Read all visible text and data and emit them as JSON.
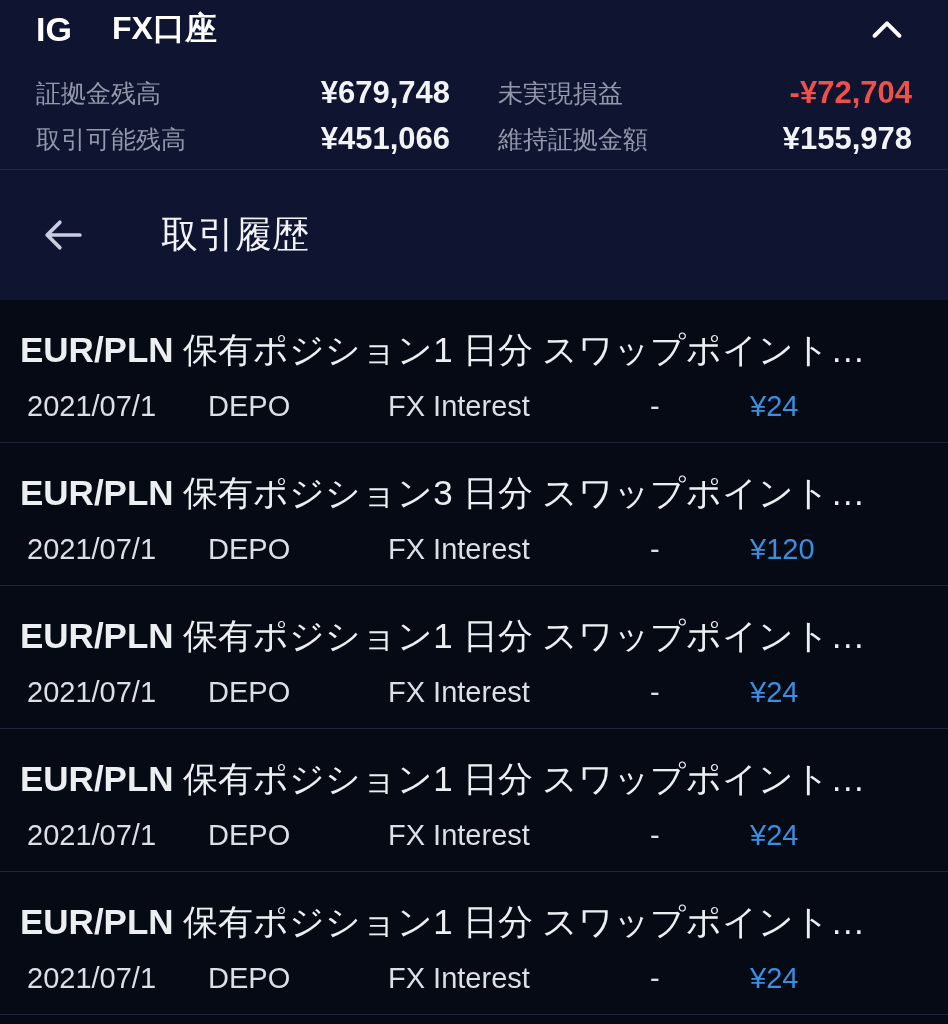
{
  "account": {
    "logo": "IG",
    "title": "FX口座",
    "expanded": true,
    "stats": [
      {
        "label": "証拠金残高",
        "value": "¥679,748",
        "negative": false
      },
      {
        "label": "未実現損益",
        "value": "-¥72,704",
        "negative": true
      },
      {
        "label": "取引可能残高",
        "value": "¥451,066",
        "negative": false
      },
      {
        "label": "維持証拠金額",
        "value": "¥155,978",
        "negative": false
      }
    ]
  },
  "nav": {
    "title": "取引履歴"
  },
  "transactions": [
    {
      "title": "**EUR/PLN** 保有ポジション1 日分 スワップポイント…",
      "date": "2021/07/1",
      "type": "DEPO",
      "description": "FX Interest",
      "column_4": "-",
      "amount": "¥24"
    },
    {
      "title": "**EUR/PLN** 保有ポジション3 日分 スワップポイント…",
      "date": "2021/07/1",
      "type": "DEPO",
      "description": "FX Interest",
      "column_4": "-",
      "amount": "¥120"
    },
    {
      "title": "**EUR/PLN** 保有ポジション1 日分 スワップポイント…",
      "date": "2021/07/1",
      "type": "DEPO",
      "description": "FX Interest",
      "column_4": "-",
      "amount": "¥24"
    },
    {
      "title": "**EUR/PLN** 保有ポジション1 日分 スワップポイント…",
      "date": "2021/07/1",
      "type": "DEPO",
      "description": "FX Interest",
      "column_4": "-",
      "amount": "¥24"
    },
    {
      "title": "**EUR/PLN** 保有ポジション1 日分 スワップポイント…",
      "date": "2021/07/1",
      "type": "DEPO",
      "description": "FX Interest",
      "column_4": "-",
      "amount": "¥24"
    }
  ]
}
